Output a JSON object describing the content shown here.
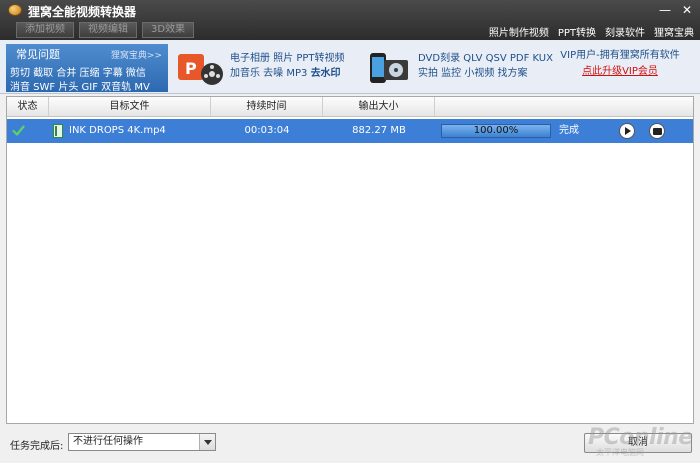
{
  "window": {
    "title": "狸窝全能视频转换器",
    "controls": [
      "—",
      "✕"
    ]
  },
  "toolbar": {
    "buttons": [
      "添加视频",
      "视频编辑",
      "3D效果"
    ]
  },
  "top_links": [
    "照片制作视频",
    "PPT转换",
    "刻录软件",
    "狸窝宝典"
  ],
  "faq": {
    "title": "常见问题",
    "more": "狸窝宝典>>",
    "row1": "剪切 截取 合并 压缩 字幕 微信",
    "row2": "消音 SWF 片头 GIF 双音轨 MV"
  },
  "promo1": {
    "icon": "ppt-film-icon",
    "line1": "电子相册 照片 PPT转视频",
    "line2_a": "加音乐 去噪 MP3 ",
    "line2_b": "去水印"
  },
  "promo2": {
    "icon": "phone-dvd-icon",
    "line1": "DVD刻录 QLV QSV PDF KUX",
    "line2": "实拍 监控 小视频 找方案"
  },
  "vip": {
    "line1": "VIP用户-拥有狸窝所有软件",
    "line2": "点此升级VIP会员"
  },
  "table": {
    "columns": [
      "状态",
      "目标文件",
      "持续时间",
      "输出大小",
      ""
    ],
    "rows": [
      {
        "status_icon": "check-icon",
        "file_icon": "video-file-icon",
        "file": "INK DROPS 4K.mp4",
        "duration": "00:03:04",
        "size": "882.27 MB",
        "progress_value": 1.0,
        "progress_label": "100.00%",
        "state": "完成"
      }
    ]
  },
  "footer": {
    "label": "任务完成后:",
    "select_value": "不进行任何操作",
    "cancel": "取消"
  },
  "watermark": {
    "main": "PConline",
    "sub": "太平洋电脑网"
  },
  "colors": {
    "titlebar": "#2c2c2c",
    "accent": "#3d7fd6",
    "vip_red": "#d01010",
    "link_blue": "#1f4f8a"
  }
}
